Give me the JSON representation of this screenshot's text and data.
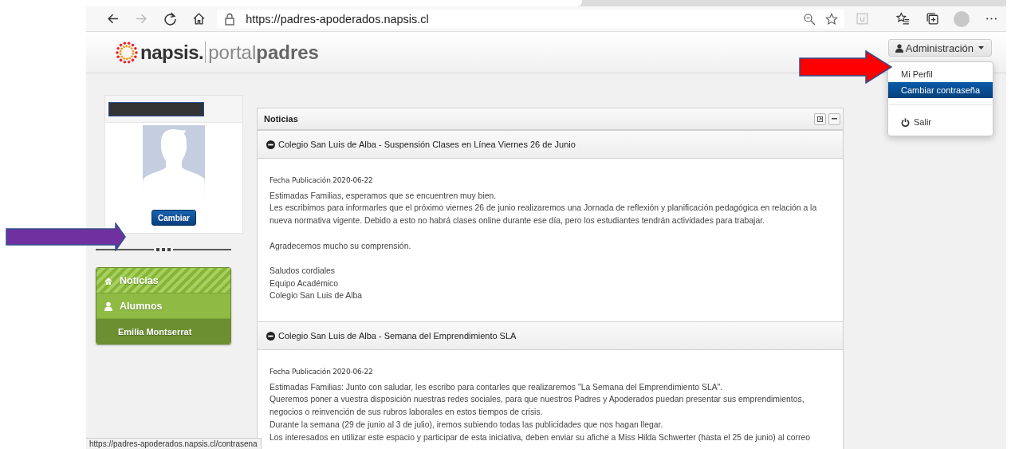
{
  "browser": {
    "url": "https://padres-apoderados.napsis.cl",
    "status_url": "https://padres-apoderados.napsis.cl/contrasena"
  },
  "header": {
    "logo_brand": "napsis.",
    "logo_portal": "portal",
    "logo_padres": "padres",
    "admin_button": "Administración"
  },
  "admin_menu": {
    "items": [
      {
        "label": "Mi Perfil",
        "kind": "item",
        "selected": false
      },
      {
        "label": "Cambiar contraseña",
        "kind": "item",
        "selected": true
      },
      {
        "label": "Salir",
        "kind": "logout",
        "selected": false
      }
    ]
  },
  "profile": {
    "button": "Cambiar"
  },
  "sidebar": {
    "items": [
      {
        "label": "Noticias",
        "kind": "home",
        "selected": true
      },
      {
        "label": "Alumnos",
        "kind": "user",
        "selected": false,
        "children": [
          {
            "label": "Emilia Montserrat",
            "selected": false
          }
        ]
      }
    ]
  },
  "news": {
    "title": "Noticias",
    "items": [
      {
        "title": "Colegio San Luis de Alba - Suspensión Clases en Línea Viernes 26 de Junio",
        "date": "Fecha Publicación 2020-06-22",
        "paragraphs": [
          [
            "Estimadas Familias, esperamos que se encuentren muy bien.",
            "Les escribimos para informarles que el próximo viernes 26 de junio realizaremos una Jornada de reflexión y planificación pedagógica en relación a la nueva normativa vigente. Debido a esto no habrá clases online durante ese día, pero los estudiantes tendrán actividades para trabajar."
          ],
          [
            "Agradecemos mucho su comprensión."
          ],
          [
            "Saludos cordiales",
            "Equipo Académico",
            "Colegio San Luis de Alba"
          ]
        ]
      },
      {
        "title": "Colegio San Luis de Alba - Semana del Emprendimiento SLA",
        "date": "Fecha Publicación 2020-06-22",
        "paragraphs": [
          [
            "Estimadas Familias: Junto con saludar, les escribo para contarles que realizaremos \"La Semana del Emprendimiento SLA\".",
            "Queremos poner a vuestra disposición nuestras redes sociales, para que nuestros Padres y Apoderados puedan presentar sus emprendimientos, negocios o reinvención de sus rubros laborales en estos tiempos de crisis.",
            "Durante la semana (29 de junio al 3 de julio), iremos subiendo todas las publicidades que nos hagan llegar.",
            "Los interesados en utilizar este espacio y participar de esta iniciativa, deben enviar su afiche a Miss Hilda Schwerter (hasta el 25 de junio) al correo"
          ]
        ]
      }
    ]
  }
}
